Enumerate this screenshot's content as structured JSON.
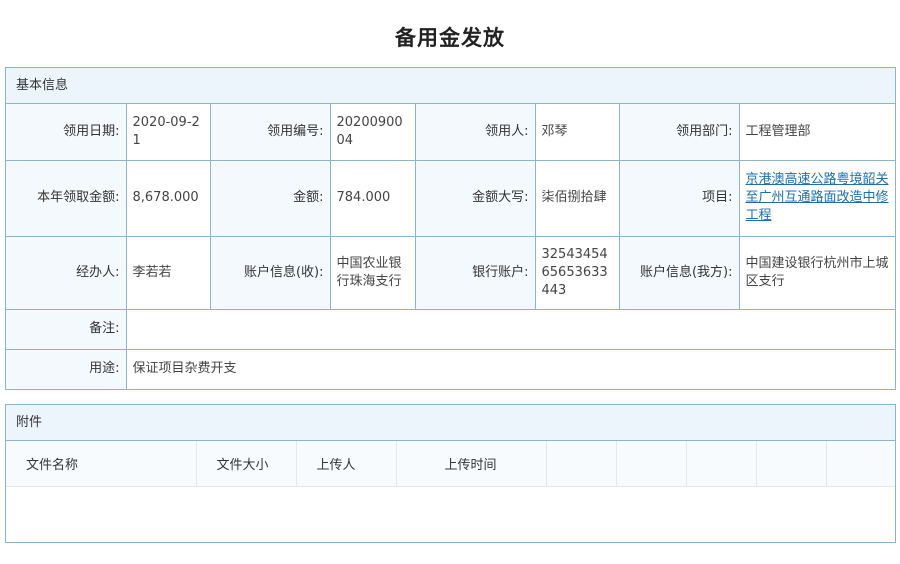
{
  "page": {
    "title": "备用金发放"
  },
  "basic": {
    "header": "基本信息",
    "row1": {
      "date_label": "领用日期:",
      "date_value": "2020-09-21",
      "no_label": "领用编号:",
      "no_value": "2020090004",
      "person_label": "领用人:",
      "person_value": "邓琴",
      "dept_label": "领用部门:",
      "dept_value": "工程管理部"
    },
    "row2": {
      "year_label": "本年领取金额:",
      "year_value": "8,678.000",
      "amount_label": "金额:",
      "amount_value": "784.000",
      "capital_label": "金额大写:",
      "capital_value": "柒佰捌拾肆",
      "project_label": "项目:",
      "project_value": "京港澳高速公路粤境韶关至广州互通路面改造中修工程"
    },
    "row3": {
      "handler_label": "经办人:",
      "handler_value": "李若若",
      "recv_acct_label": "账户信息(收):",
      "recv_acct_value": "中国农业银行珠海支行",
      "bank_no_label": "银行账户:",
      "bank_no_value": "3254345465653633443",
      "my_acct_label": "账户信息(我方):",
      "my_acct_value": "中国建设银行杭州市上城区支行"
    },
    "remark_label": "备注:",
    "remark_value": "",
    "usage_label": "用途:",
    "usage_value": "保证项目杂费开支"
  },
  "attachments": {
    "header": "附件",
    "columns": [
      "文件名称",
      "文件大小",
      "上传人",
      "上传时间",
      "",
      "",
      "",
      "",
      ""
    ],
    "rows": []
  }
}
